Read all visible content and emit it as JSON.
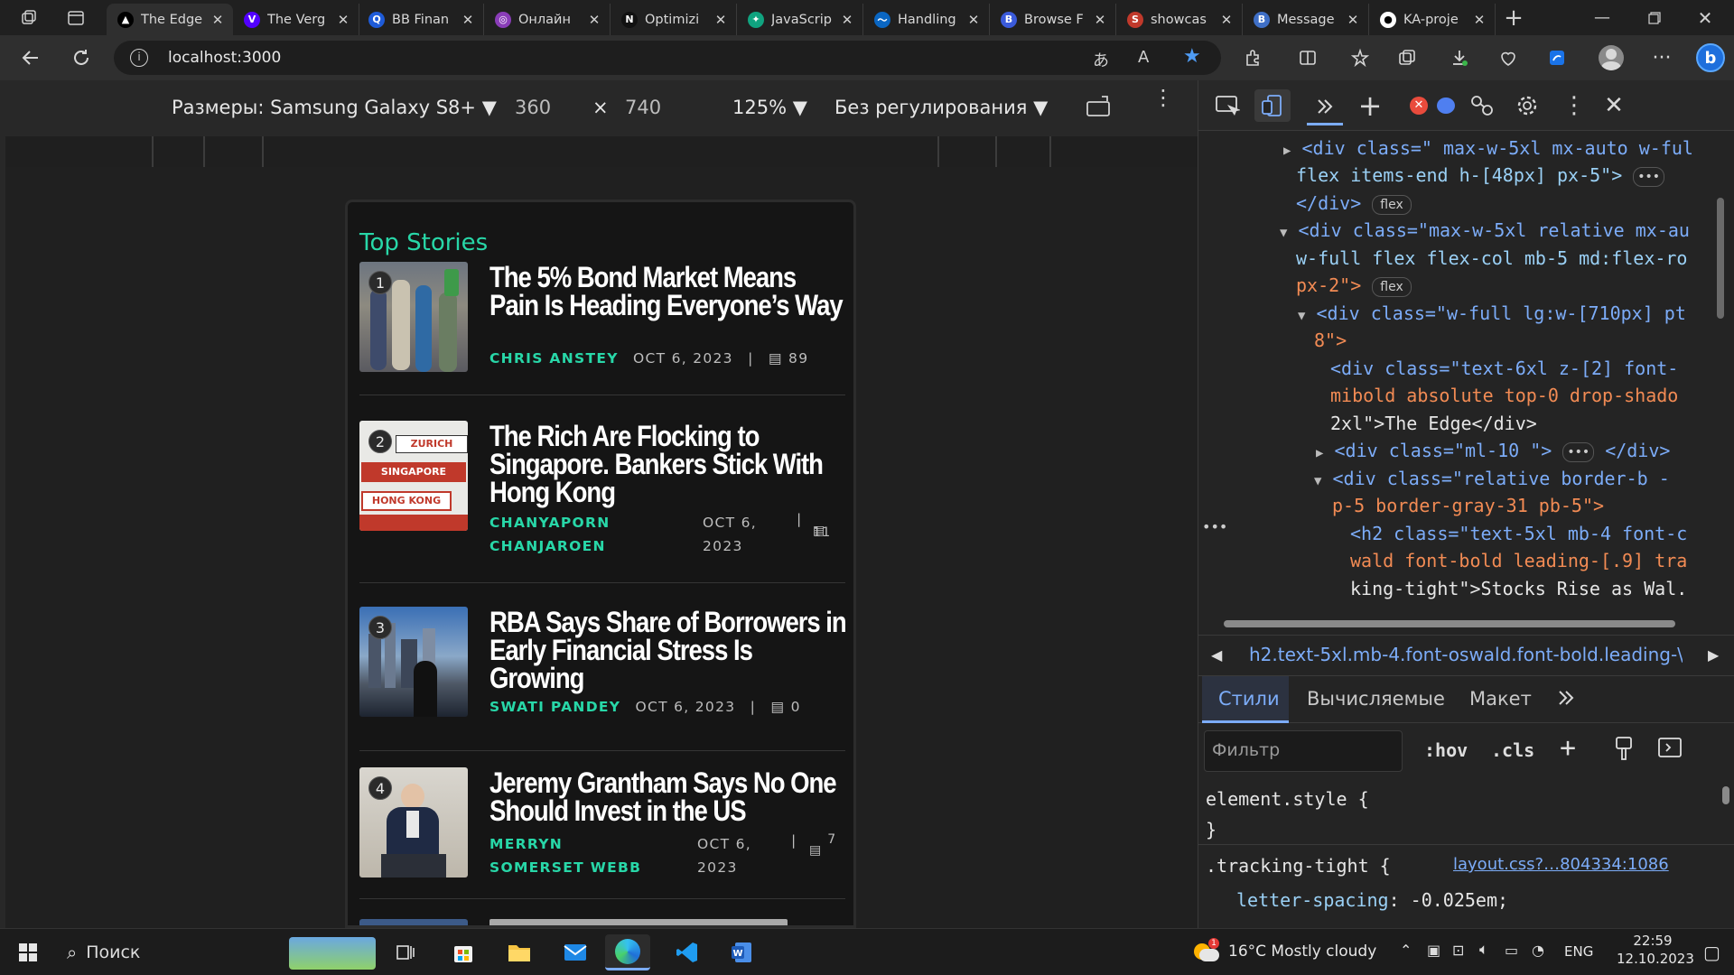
{
  "tabs": [
    {
      "title": "The Edge",
      "fav_bg": "#000000",
      "fav_glyph": "▲",
      "active": true
    },
    {
      "title": "The Verg",
      "fav_bg": "#5200ff",
      "fav_glyph": "V"
    },
    {
      "title": "BB Finan",
      "fav_bg": "#1e5bd8",
      "fav_glyph": "Q"
    },
    {
      "title": "Онлайн",
      "fav_bg": "#8a3db8",
      "fav_glyph": "◎"
    },
    {
      "title": "Optimizi",
      "fav_bg": "#111111",
      "fav_glyph": "N"
    },
    {
      "title": "JavaScrip",
      "fav_bg": "#10a37f",
      "fav_glyph": "✦"
    },
    {
      "title": "Handling",
      "fav_bg": "#0a66c2",
      "fav_glyph": "〜"
    },
    {
      "title": "Browse F",
      "fav_bg": "#3b5bdb",
      "fav_glyph": "B"
    },
    {
      "title": "showcas",
      "fav_bg": "#c0392b",
      "fav_glyph": "S"
    },
    {
      "title": "Message",
      "fav_bg": "#3f6fc6",
      "fav_glyph": "B"
    },
    {
      "title": "KA-proje",
      "fav_bg": "#ffffff",
      "fav_glyph": "●"
    }
  ],
  "address": {
    "url": "localhost:3000"
  },
  "device_toolbar": {
    "dimensions_label": "Размеры: Samsung Galaxy S8+",
    "width": "360",
    "times": "×",
    "height": "740",
    "zoom": "125%",
    "throttle": "Без регулирования"
  },
  "page": {
    "section_title": "Top Stories",
    "stories": [
      {
        "rank": "1",
        "headline": "The 5% Bond Market Means Pain Is Heading Everyone’s Way",
        "author": "CHRIS ANSTEY",
        "date": "OCT 6, 2023",
        "sep": "|",
        "comments": "89"
      },
      {
        "rank": "2",
        "headline": "The Rich Are Flocking to Singapore. Bankers Stick With Hong Kong",
        "author": "CHANYAPORN CHANJAROEN",
        "date": "OCT 6, 2023",
        "sep": "|",
        "comments": "11",
        "signs": [
          "ZURICH",
          "SINGAPORE",
          "HONG KONG"
        ]
      },
      {
        "rank": "3",
        "headline": "RBA Says Share of Borrowers in Early Financial Stress Is Growing",
        "author": "SWATI PANDEY",
        "date": "OCT 6, 2023",
        "sep": "|",
        "comments": "0"
      },
      {
        "rank": "4",
        "headline": "Jeremy Grantham Says No One Should Invest in the US",
        "author": "MERRYN SOMERSET WEBB",
        "date": "OCT 6, 2023",
        "sep": "|",
        "comments": "7"
      }
    ]
  },
  "devtools": {
    "dom_lines": [
      {
        "indent": 0,
        "arrow": "▶",
        "html": "<div class=\" max-w-5xl mx-auto w-ful"
      },
      {
        "indent": 0,
        "arrow": "",
        "html": "flex items-end h-[48px] px-5\">"
      },
      {
        "indent": 0,
        "arrow": "",
        "html": "</div>"
      },
      {
        "indent": 0,
        "arrow": "▼",
        "html": "<div class=\"max-w-5xl relative mx-au"
      },
      {
        "indent": 0,
        "arrow": "",
        "html": "w-full flex flex-col mb-5 md:flex-ro"
      },
      {
        "indent": 0,
        "arrow": "",
        "html": "px-2\">"
      },
      {
        "indent": 1,
        "arrow": "▼",
        "html": "<div class=\"w-full lg:w-[710px] pt"
      },
      {
        "indent": 1,
        "arrow": "",
        "html": "8\">"
      },
      {
        "indent": 2,
        "arrow": "",
        "html": "<div class=\"text-6xl z-[2] font-"
      },
      {
        "indent": 2,
        "arrow": "",
        "html": "mibold absolute top-0 drop-shado"
      },
      {
        "indent": 2,
        "arrow": "",
        "html": "2xl\">The Edge</div>"
      },
      {
        "indent": 2,
        "arrow": "▶",
        "html": "<div class=\"ml-10 \">"
      },
      {
        "indent": 2,
        "arrow": "▼",
        "html": "<div class=\"relative border-b  -"
      },
      {
        "indent": 2,
        "arrow": "",
        "html": "p-5 border-gray-31 pb-5\">"
      },
      {
        "indent": 3,
        "arrow": "",
        "html": "<h2 class=\"text-5xl mb-4 font-c"
      },
      {
        "indent": 3,
        "arrow": "",
        "html": "wald font-bold leading-[.9] tra"
      },
      {
        "indent": 3,
        "arrow": "",
        "html": "king-tight\">Stocks Rise as Wal."
      }
    ],
    "flex_pill": "flex",
    "ellipsis": "•••",
    "breadcrumb": "h2.text-5xl.mb-4.font-oswald.font-bold.leading-\\[",
    "panel_tabs": [
      "Стили",
      "Вычисляемые",
      "Макет"
    ],
    "filter_placeholder": "Фильтр",
    "hov": ":hov",
    "cls": ".cls",
    "rules": {
      "element_style": "element.style {",
      "close": "}",
      "selector": ".tracking-tight {",
      "source": "layout.css?…804334:1086",
      "prop": "letter-spacing",
      "value": "-0.025em;"
    }
  },
  "taskbar": {
    "search": "Поиск",
    "weather": "16°C  Mostly cloudy",
    "lang": "ENG",
    "time": "22:59",
    "date": "12.10.2023"
  },
  "colors": {
    "accent": "#28d7a8",
    "blue": "#7cacf8"
  }
}
